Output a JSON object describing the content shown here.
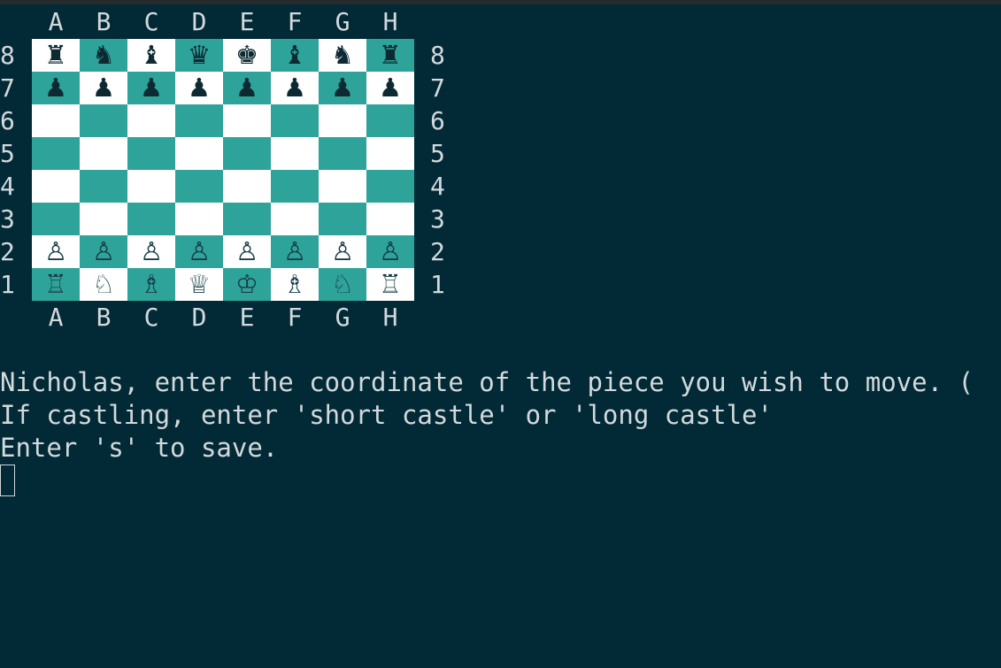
{
  "file_labels": [
    "A",
    "B",
    "C",
    "D",
    "E",
    "F",
    "G",
    "H"
  ],
  "rank_labels": [
    "8",
    "7",
    "6",
    "5",
    "4",
    "3",
    "2",
    "1"
  ],
  "board_rows": [
    [
      "♜",
      "♞",
      "♝",
      "♛",
      "♚",
      "♝",
      "♞",
      "♜"
    ],
    [
      "♟",
      "♟",
      "♟",
      "♟",
      "♟",
      "♟",
      "♟",
      "♟"
    ],
    [
      "",
      "",
      "",
      "",
      "",
      "",
      "",
      ""
    ],
    [
      "",
      "",
      "",
      "",
      "",
      "",
      "",
      ""
    ],
    [
      "",
      "",
      "",
      "",
      "",
      "",
      "",
      ""
    ],
    [
      "",
      "",
      "",
      "",
      "",
      "",
      "",
      ""
    ],
    [
      "♙",
      "♙",
      "♙",
      "♙",
      "♙",
      "♙",
      "♙",
      "♙"
    ],
    [
      "♖",
      "♘",
      "♗",
      "♕",
      "♔",
      "♗",
      "♘",
      "♖"
    ]
  ],
  "colors": {
    "background": "#012a36",
    "light_square": "#ffffff",
    "dark_square": "#2ea39a",
    "text": "#d3d9dc"
  },
  "terminal": {
    "line1": "Nicholas, enter the coordinate of the piece you wish to move. (",
    "line2": "If castling, enter 'short castle' or 'long castle'",
    "line3": "Enter 's' to save."
  }
}
